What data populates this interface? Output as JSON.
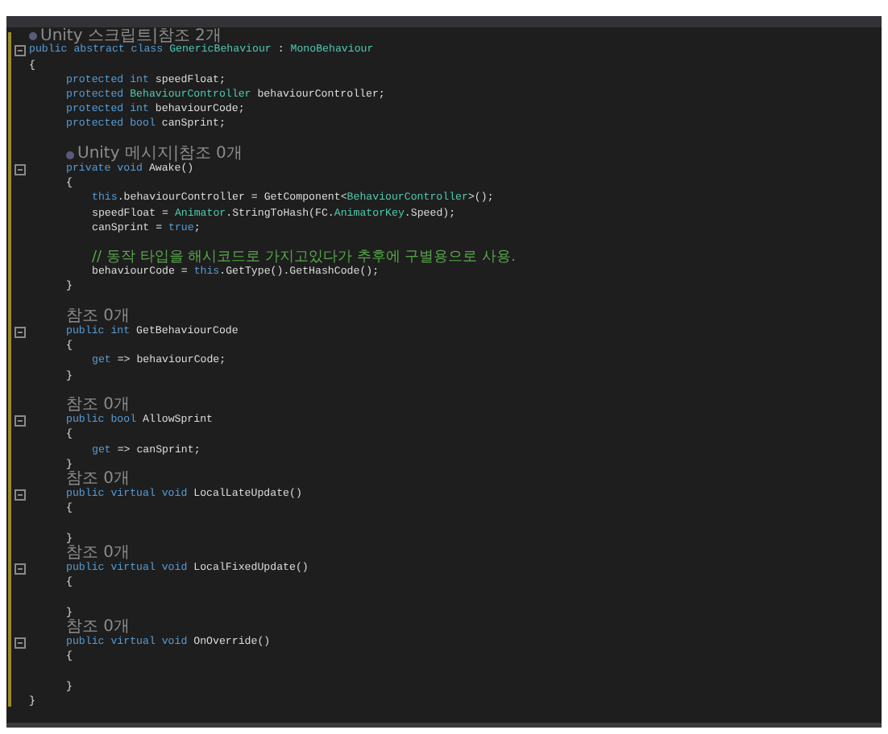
{
  "editor": {
    "lines": [
      {
        "kind": "lens_unity",
        "text": "Unity 스크립트|참조 2개"
      },
      {
        "kind": "code",
        "fold": true,
        "tokens": [
          {
            "t": "public abstract class ",
            "kind": "kw"
          },
          {
            "t": "GenericBehaviour",
            "kind": "type"
          },
          {
            "t": " : ",
            "kind": "plain"
          },
          {
            "t": "MonoBehaviour",
            "kind": "type"
          }
        ]
      },
      {
        "kind": "code",
        "fold": false,
        "tokens": [
          {
            "t": "{",
            "kind": "plain"
          }
        ]
      },
      {
        "kind": "block",
        "children": [
          {
            "kind": "code",
            "fold": false,
            "tokens": [
              {
                "t": "protected int",
                "kind": "kw"
              },
              {
                "t": " speedFloat;",
                "kind": "plain"
              }
            ]
          },
          {
            "kind": "code",
            "fold": false,
            "tokens": [
              {
                "t": "protected ",
                "kind": "kw"
              },
              {
                "t": "BehaviourController",
                "kind": "type"
              },
              {
                "t": " behaviourController;",
                "kind": "plain"
              }
            ]
          },
          {
            "kind": "code",
            "fold": false,
            "tokens": [
              {
                "t": "protected int",
                "kind": "kw"
              },
              {
                "t": " behaviourCode;",
                "kind": "plain"
              }
            ]
          },
          {
            "kind": "code",
            "fold": false,
            "tokens": [
              {
                "t": "protected bool",
                "kind": "kw"
              },
              {
                "t": " canSprint;",
                "kind": "plain"
              }
            ]
          },
          {
            "kind": "blank"
          },
          {
            "kind": "lens_unity",
            "text": "Unity 메시지|참조 0개"
          },
          {
            "kind": "code",
            "fold": true,
            "tokens": [
              {
                "t": "private void",
                "kind": "kw"
              },
              {
                "t": " Awake()",
                "kind": "plain"
              }
            ]
          },
          {
            "kind": "code",
            "fold": false,
            "tokens": [
              {
                "t": "{",
                "kind": "plain"
              }
            ]
          },
          {
            "kind": "block",
            "children": [
              {
                "kind": "code",
                "fold": false,
                "tokens": [
                  {
                    "t": "this",
                    "kind": "kw"
                  },
                  {
                    "t": ".behaviourController = GetComponent<",
                    "kind": "plain"
                  },
                  {
                    "t": "BehaviourController",
                    "kind": "type"
                  },
                  {
                    "t": ">();",
                    "kind": "plain"
                  }
                ]
              },
              {
                "kind": "code",
                "fold": false,
                "tokens": [
                  {
                    "t": "speedFloat = ",
                    "kind": "plain"
                  },
                  {
                    "t": "Animator",
                    "kind": "type"
                  },
                  {
                    "t": ".StringToHash(FC.",
                    "kind": "plain"
                  },
                  {
                    "t": "AnimatorKey",
                    "kind": "type"
                  },
                  {
                    "t": ".Speed);",
                    "kind": "plain"
                  }
                ]
              },
              {
                "kind": "code",
                "fold": false,
                "tokens": [
                  {
                    "t": "canSprint = ",
                    "kind": "plain"
                  },
                  {
                    "t": "true",
                    "kind": "kw"
                  },
                  {
                    "t": ";",
                    "kind": "plain"
                  }
                ]
              },
              {
                "kind": "blank"
              },
              {
                "kind": "code",
                "fold": false,
                "tokens": [
                  {
                    "t": "// 동작 타입을 해시코드로 가지고있다가 추후에 구별용으로 사용.",
                    "kind": "comment"
                  }
                ]
              },
              {
                "kind": "code",
                "fold": false,
                "tokens": [
                  {
                    "t": "behaviourCode = ",
                    "kind": "plain"
                  },
                  {
                    "t": "this",
                    "kind": "kw"
                  },
                  {
                    "t": ".GetType().GetHashCode();",
                    "kind": "plain"
                  }
                ]
              }
            ]
          },
          {
            "kind": "code",
            "fold": false,
            "tokens": [
              {
                "t": "}",
                "kind": "plain"
              }
            ]
          },
          {
            "kind": "blank"
          },
          {
            "kind": "lens",
            "text": "참조 0개"
          },
          {
            "kind": "code",
            "fold": true,
            "tokens": [
              {
                "t": "public int",
                "kind": "kw"
              },
              {
                "t": " GetBehaviourCode",
                "kind": "plain"
              }
            ]
          },
          {
            "kind": "code",
            "fold": false,
            "tokens": [
              {
                "t": "{",
                "kind": "plain"
              }
            ]
          },
          {
            "kind": "block",
            "children": [
              {
                "kind": "code",
                "fold": false,
                "tokens": [
                  {
                    "t": "get",
                    "kind": "kw"
                  },
                  {
                    "t": " => behaviourCode;",
                    "kind": "plain"
                  }
                ]
              }
            ]
          },
          {
            "kind": "code",
            "fold": false,
            "tokens": [
              {
                "t": "}",
                "kind": "plain"
              }
            ]
          },
          {
            "kind": "blank"
          },
          {
            "kind": "lens",
            "text": "참조 0개"
          },
          {
            "kind": "code",
            "fold": true,
            "tokens": [
              {
                "t": "public bool",
                "kind": "kw"
              },
              {
                "t": " AllowSprint",
                "kind": "plain"
              }
            ]
          },
          {
            "kind": "code",
            "fold": false,
            "tokens": [
              {
                "t": "{",
                "kind": "plain"
              }
            ]
          },
          {
            "kind": "block",
            "children": [
              {
                "kind": "code",
                "fold": false,
                "tokens": [
                  {
                    "t": "get",
                    "kind": "kw"
                  },
                  {
                    "t": " => canSprint;",
                    "kind": "plain"
                  }
                ]
              }
            ]
          },
          {
            "kind": "code",
            "fold": false,
            "tokens": [
              {
                "t": "}",
                "kind": "plain"
              }
            ]
          },
          {
            "kind": "lens",
            "text": "참조 0개"
          },
          {
            "kind": "code",
            "fold": true,
            "tokens": [
              {
                "t": "public virtual void",
                "kind": "kw"
              },
              {
                "t": " LocalLateUpdate()",
                "kind": "plain"
              }
            ]
          },
          {
            "kind": "code",
            "fold": false,
            "tokens": [
              {
                "t": "{",
                "kind": "plain"
              }
            ]
          },
          {
            "kind": "blank"
          },
          {
            "kind": "code",
            "fold": false,
            "tokens": [
              {
                "t": "}",
                "kind": "plain"
              }
            ]
          },
          {
            "kind": "lens",
            "text": "참조 0개"
          },
          {
            "kind": "code",
            "fold": true,
            "tokens": [
              {
                "t": "public virtual void",
                "kind": "kw"
              },
              {
                "t": " LocalFixedUpdate()",
                "kind": "plain"
              }
            ]
          },
          {
            "kind": "code",
            "fold": false,
            "tokens": [
              {
                "t": "{",
                "kind": "plain"
              }
            ]
          },
          {
            "kind": "blank"
          },
          {
            "kind": "code",
            "fold": false,
            "tokens": [
              {
                "t": "}",
                "kind": "plain"
              }
            ]
          },
          {
            "kind": "lens",
            "text": "참조 0개"
          },
          {
            "kind": "code",
            "fold": true,
            "tokens": [
              {
                "t": "public virtual void",
                "kind": "kw"
              },
              {
                "t": " OnOverride()",
                "kind": "plain"
              }
            ]
          },
          {
            "kind": "code",
            "fold": false,
            "tokens": [
              {
                "t": "{",
                "kind": "plain"
              }
            ]
          },
          {
            "kind": "blank"
          },
          {
            "kind": "code",
            "fold": false,
            "tokens": [
              {
                "t": "}",
                "kind": "plain"
              }
            ]
          }
        ]
      },
      {
        "kind": "code",
        "fold": false,
        "tokens": [
          {
            "t": "}",
            "kind": "plain"
          }
        ]
      }
    ]
  }
}
